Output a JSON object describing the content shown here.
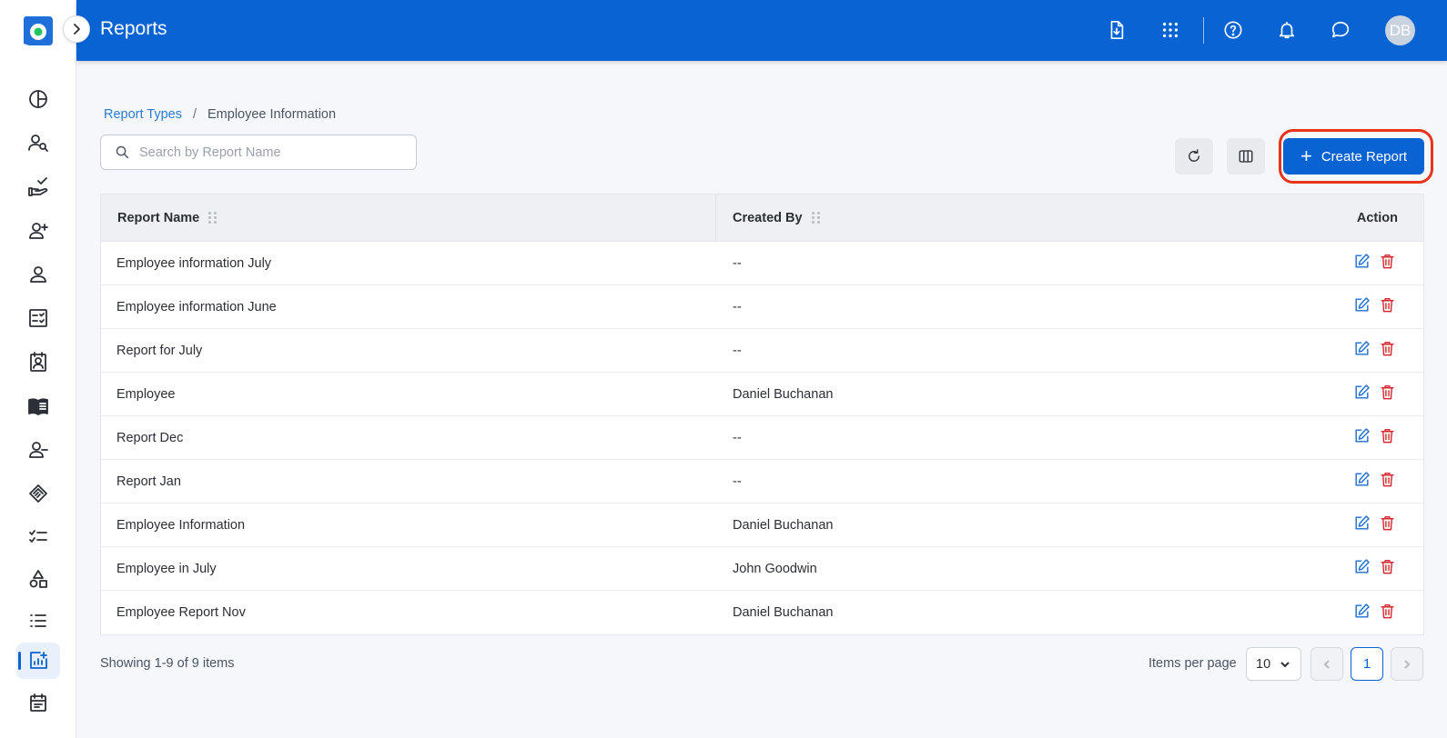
{
  "header": {
    "title": "Reports",
    "avatar_initials": "DB",
    "icons": [
      "file-download-icon",
      "apps-grid-icon",
      "help-icon",
      "bell-icon",
      "chat-icon"
    ]
  },
  "sidebar": {
    "icons": [
      "dashboard-icon",
      "person-search-icon",
      "task-hand-icon",
      "add-person-icon",
      "person-icon",
      "checklist-board-icon",
      "contact-badge-icon",
      "book-icon",
      "person-remove-icon",
      "handshake-icon",
      "checklist-icon",
      "shapes-icon",
      "list-icon",
      "reports-icon",
      "calendar-icon"
    ],
    "active": "reports-icon"
  },
  "breadcrumb": {
    "parent": "Report Types",
    "separator": "/",
    "current": "Employee Information"
  },
  "search": {
    "placeholder": "Search by Report Name",
    "value": ""
  },
  "toolbar": {
    "create_label": "Create Report"
  },
  "table": {
    "columns": {
      "name": "Report Name",
      "created_by": "Created By",
      "action": "Action"
    },
    "rows": [
      {
        "name": "Employee information July",
        "created_by": "--"
      },
      {
        "name": "Employee information June",
        "created_by": "--"
      },
      {
        "name": "Report for July",
        "created_by": "--"
      },
      {
        "name": "Employee",
        "created_by": "Daniel Buchanan"
      },
      {
        "name": "Report Dec",
        "created_by": "--"
      },
      {
        "name": "Report Jan",
        "created_by": "--"
      },
      {
        "name": "Employee Information",
        "created_by": "Daniel Buchanan"
      },
      {
        "name": "Employee in July",
        "created_by": "John Goodwin"
      },
      {
        "name": "Employee Report Nov",
        "created_by": "Daniel Buchanan"
      }
    ]
  },
  "footer": {
    "showing": "Showing 1-9 of 9 items",
    "items_per_page_label": "Items per page",
    "items_per_page_value": "10",
    "current_page": "1"
  },
  "colors": {
    "primary": "#0963d2",
    "highlight_ring": "#e8341c",
    "delete": "#d6282e"
  }
}
